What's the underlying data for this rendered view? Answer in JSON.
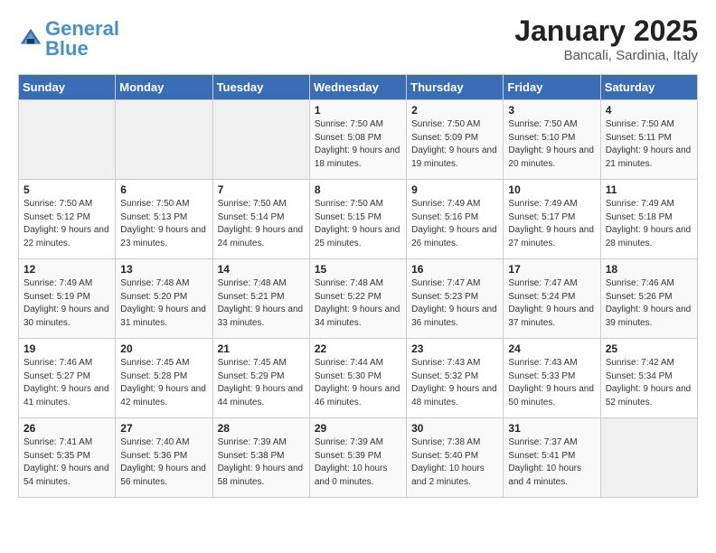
{
  "header": {
    "logo_general": "General",
    "logo_blue": "Blue",
    "month_title": "January 2025",
    "location": "Bancali, Sardinia, Italy"
  },
  "weekdays": [
    "Sunday",
    "Monday",
    "Tuesday",
    "Wednesday",
    "Thursday",
    "Friday",
    "Saturday"
  ],
  "weeks": [
    [
      {
        "day": "",
        "sunrise": "",
        "sunset": "",
        "daylight": ""
      },
      {
        "day": "",
        "sunrise": "",
        "sunset": "",
        "daylight": ""
      },
      {
        "day": "",
        "sunrise": "",
        "sunset": "",
        "daylight": ""
      },
      {
        "day": "1",
        "sunrise": "Sunrise: 7:50 AM",
        "sunset": "Sunset: 5:08 PM",
        "daylight": "Daylight: 9 hours and 18 minutes."
      },
      {
        "day": "2",
        "sunrise": "Sunrise: 7:50 AM",
        "sunset": "Sunset: 5:09 PM",
        "daylight": "Daylight: 9 hours and 19 minutes."
      },
      {
        "day": "3",
        "sunrise": "Sunrise: 7:50 AM",
        "sunset": "Sunset: 5:10 PM",
        "daylight": "Daylight: 9 hours and 20 minutes."
      },
      {
        "day": "4",
        "sunrise": "Sunrise: 7:50 AM",
        "sunset": "Sunset: 5:11 PM",
        "daylight": "Daylight: 9 hours and 21 minutes."
      }
    ],
    [
      {
        "day": "5",
        "sunrise": "Sunrise: 7:50 AM",
        "sunset": "Sunset: 5:12 PM",
        "daylight": "Daylight: 9 hours and 22 minutes."
      },
      {
        "day": "6",
        "sunrise": "Sunrise: 7:50 AM",
        "sunset": "Sunset: 5:13 PM",
        "daylight": "Daylight: 9 hours and 23 minutes."
      },
      {
        "day": "7",
        "sunrise": "Sunrise: 7:50 AM",
        "sunset": "Sunset: 5:14 PM",
        "daylight": "Daylight: 9 hours and 24 minutes."
      },
      {
        "day": "8",
        "sunrise": "Sunrise: 7:50 AM",
        "sunset": "Sunset: 5:15 PM",
        "daylight": "Daylight: 9 hours and 25 minutes."
      },
      {
        "day": "9",
        "sunrise": "Sunrise: 7:49 AM",
        "sunset": "Sunset: 5:16 PM",
        "daylight": "Daylight: 9 hours and 26 minutes."
      },
      {
        "day": "10",
        "sunrise": "Sunrise: 7:49 AM",
        "sunset": "Sunset: 5:17 PM",
        "daylight": "Daylight: 9 hours and 27 minutes."
      },
      {
        "day": "11",
        "sunrise": "Sunrise: 7:49 AM",
        "sunset": "Sunset: 5:18 PM",
        "daylight": "Daylight: 9 hours and 28 minutes."
      }
    ],
    [
      {
        "day": "12",
        "sunrise": "Sunrise: 7:49 AM",
        "sunset": "Sunset: 5:19 PM",
        "daylight": "Daylight: 9 hours and 30 minutes."
      },
      {
        "day": "13",
        "sunrise": "Sunrise: 7:48 AM",
        "sunset": "Sunset: 5:20 PM",
        "daylight": "Daylight: 9 hours and 31 minutes."
      },
      {
        "day": "14",
        "sunrise": "Sunrise: 7:48 AM",
        "sunset": "Sunset: 5:21 PM",
        "daylight": "Daylight: 9 hours and 33 minutes."
      },
      {
        "day": "15",
        "sunrise": "Sunrise: 7:48 AM",
        "sunset": "Sunset: 5:22 PM",
        "daylight": "Daylight: 9 hours and 34 minutes."
      },
      {
        "day": "16",
        "sunrise": "Sunrise: 7:47 AM",
        "sunset": "Sunset: 5:23 PM",
        "daylight": "Daylight: 9 hours and 36 minutes."
      },
      {
        "day": "17",
        "sunrise": "Sunrise: 7:47 AM",
        "sunset": "Sunset: 5:24 PM",
        "daylight": "Daylight: 9 hours and 37 minutes."
      },
      {
        "day": "18",
        "sunrise": "Sunrise: 7:46 AM",
        "sunset": "Sunset: 5:26 PM",
        "daylight": "Daylight: 9 hours and 39 minutes."
      }
    ],
    [
      {
        "day": "19",
        "sunrise": "Sunrise: 7:46 AM",
        "sunset": "Sunset: 5:27 PM",
        "daylight": "Daylight: 9 hours and 41 minutes."
      },
      {
        "day": "20",
        "sunrise": "Sunrise: 7:45 AM",
        "sunset": "Sunset: 5:28 PM",
        "daylight": "Daylight: 9 hours and 42 minutes."
      },
      {
        "day": "21",
        "sunrise": "Sunrise: 7:45 AM",
        "sunset": "Sunset: 5:29 PM",
        "daylight": "Daylight: 9 hours and 44 minutes."
      },
      {
        "day": "22",
        "sunrise": "Sunrise: 7:44 AM",
        "sunset": "Sunset: 5:30 PM",
        "daylight": "Daylight: 9 hours and 46 minutes."
      },
      {
        "day": "23",
        "sunrise": "Sunrise: 7:43 AM",
        "sunset": "Sunset: 5:32 PM",
        "daylight": "Daylight: 9 hours and 48 minutes."
      },
      {
        "day": "24",
        "sunrise": "Sunrise: 7:43 AM",
        "sunset": "Sunset: 5:33 PM",
        "daylight": "Daylight: 9 hours and 50 minutes."
      },
      {
        "day": "25",
        "sunrise": "Sunrise: 7:42 AM",
        "sunset": "Sunset: 5:34 PM",
        "daylight": "Daylight: 9 hours and 52 minutes."
      }
    ],
    [
      {
        "day": "26",
        "sunrise": "Sunrise: 7:41 AM",
        "sunset": "Sunset: 5:35 PM",
        "daylight": "Daylight: 9 hours and 54 minutes."
      },
      {
        "day": "27",
        "sunrise": "Sunrise: 7:40 AM",
        "sunset": "Sunset: 5:36 PM",
        "daylight": "Daylight: 9 hours and 56 minutes."
      },
      {
        "day": "28",
        "sunrise": "Sunrise: 7:39 AM",
        "sunset": "Sunset: 5:38 PM",
        "daylight": "Daylight: 9 hours and 58 minutes."
      },
      {
        "day": "29",
        "sunrise": "Sunrise: 7:39 AM",
        "sunset": "Sunset: 5:39 PM",
        "daylight": "Daylight: 10 hours and 0 minutes."
      },
      {
        "day": "30",
        "sunrise": "Sunrise: 7:38 AM",
        "sunset": "Sunset: 5:40 PM",
        "daylight": "Daylight: 10 hours and 2 minutes."
      },
      {
        "day": "31",
        "sunrise": "Sunrise: 7:37 AM",
        "sunset": "Sunset: 5:41 PM",
        "daylight": "Daylight: 10 hours and 4 minutes."
      },
      {
        "day": "",
        "sunrise": "",
        "sunset": "",
        "daylight": ""
      }
    ]
  ]
}
